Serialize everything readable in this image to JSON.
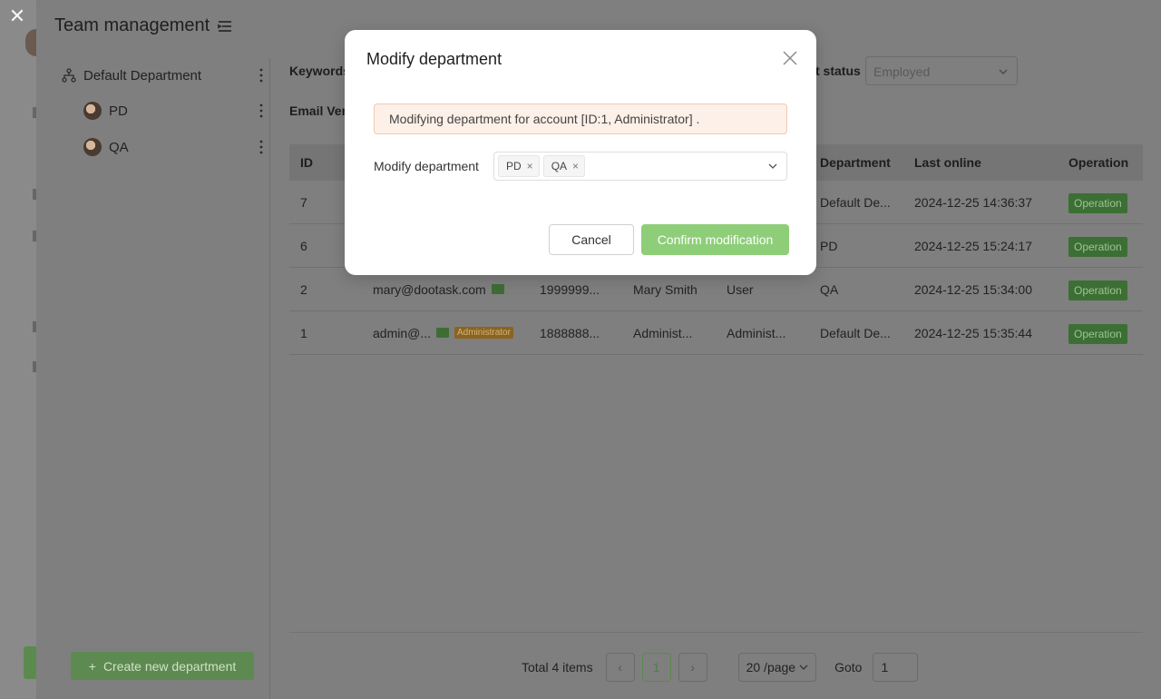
{
  "drawer": {
    "title": "Team management",
    "close_glyph": "✕"
  },
  "sidebar": {
    "items": [
      {
        "label": "Default Department",
        "icon": "org-tree-icon"
      },
      {
        "label": "PD",
        "icon": "avatar"
      },
      {
        "label": "QA",
        "icon": "avatar"
      }
    ],
    "create_button": "Create new department",
    "create_icon": "+"
  },
  "filters": {
    "keywords_label": "Keywords",
    "email_label": "Email Ver",
    "status_label": "t status",
    "status_value": "Employed"
  },
  "table": {
    "headers": {
      "id": "ID",
      "department": "Department",
      "last_online": "Last online",
      "operation": "Operation"
    },
    "rows": [
      {
        "id": "7",
        "email": "",
        "phone": "",
        "nickname": "",
        "identity": "",
        "department": "Default De...",
        "last_online": "2024-12-25 14:36:37",
        "operation": "Operation"
      },
      {
        "id": "6",
        "email": "",
        "phone": "",
        "nickname": "",
        "identity": "",
        "department": "PD",
        "last_online": "2024-12-25 15:24:17",
        "operation": "Operation"
      },
      {
        "id": "2",
        "email": "mary@dootask.com",
        "phone": "1999999...",
        "nickname": "Mary Smith",
        "identity": "User",
        "department": "QA",
        "last_online": "2024-12-25 15:34:00",
        "operation": "Operation"
      },
      {
        "id": "1",
        "email": "admin@...",
        "admin_tag": "Administrator",
        "phone": "1888888...",
        "nickname": "Administ...",
        "identity": "Administ...",
        "department": "Default De...",
        "last_online": "2024-12-25 15:35:44",
        "operation": "Operation"
      }
    ]
  },
  "pager": {
    "total": "Total 4 items",
    "prev": "‹",
    "page": "1",
    "next": "›",
    "page_size": "20 /page",
    "goto_label": "Goto",
    "goto_value": "1"
  },
  "modal": {
    "title": "Modify department",
    "alert": "Modifying department for account [ID:1, Administrator] .",
    "field_label": "Modify department",
    "tags": [
      "PD",
      "QA"
    ],
    "tag_remove": "×",
    "cancel": "Cancel",
    "confirm": "Confirm modification"
  },
  "colors": {
    "accent": "#8ece78",
    "alert_bg": "#fdf0e8",
    "alert_border": "#f2c9ae"
  }
}
